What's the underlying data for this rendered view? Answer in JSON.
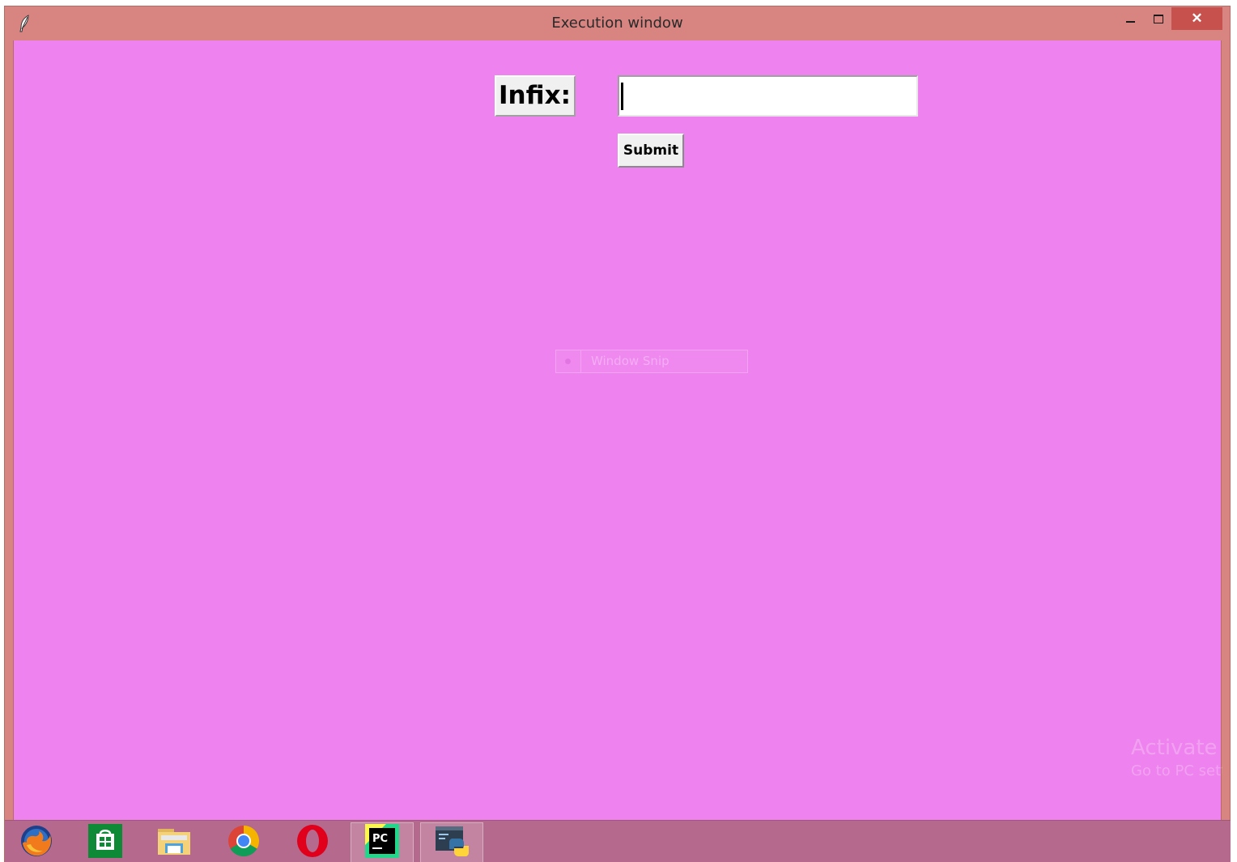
{
  "window": {
    "title": "Execution window",
    "close_glyph": "✕",
    "background_color": "#ee82ee",
    "frame_color": "#d88480"
  },
  "form": {
    "label": "Infix:",
    "input_value": "",
    "submit_label": "Submit"
  },
  "overlay": {
    "snip_label": "Window Snip"
  },
  "watermark": {
    "line1": "Activate W",
    "line2": "Go to PC setti"
  },
  "taskbar": {
    "color": "#b56a8d",
    "items": [
      {
        "icon": "firefox-icon"
      },
      {
        "icon": "store-icon"
      },
      {
        "icon": "file-explorer-icon"
      },
      {
        "icon": "chrome-icon"
      },
      {
        "icon": "opera-icon"
      },
      {
        "icon": "pycharm-icon",
        "label": "PC"
      },
      {
        "icon": "python-idle-icon"
      }
    ]
  }
}
